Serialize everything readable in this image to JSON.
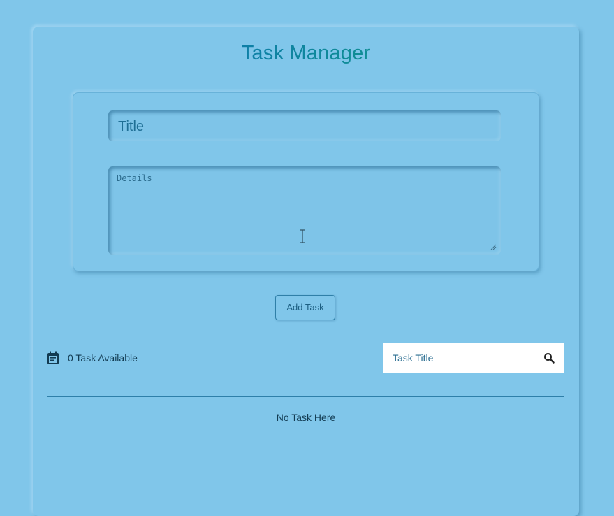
{
  "app": {
    "title": "Task Manager"
  },
  "form": {
    "title_placeholder": "Title",
    "details_placeholder": "Details",
    "add_button_label": "Add Task"
  },
  "tasks": {
    "count_label": "0 Task Available",
    "empty_message": "No Task Here"
  },
  "search": {
    "placeholder": "Task Title"
  },
  "icons": {
    "calendar": "calendar-icon",
    "search": "search-icon",
    "resize": "resize-grip-icon",
    "cursor": "text-cursor-icon"
  },
  "colors": {
    "background": "#80c6ea",
    "title_gradient_start": "#0d73b6",
    "title_gradient_end": "#119a86",
    "search_background": "#ffffff",
    "divider": "#2e7fa9"
  }
}
